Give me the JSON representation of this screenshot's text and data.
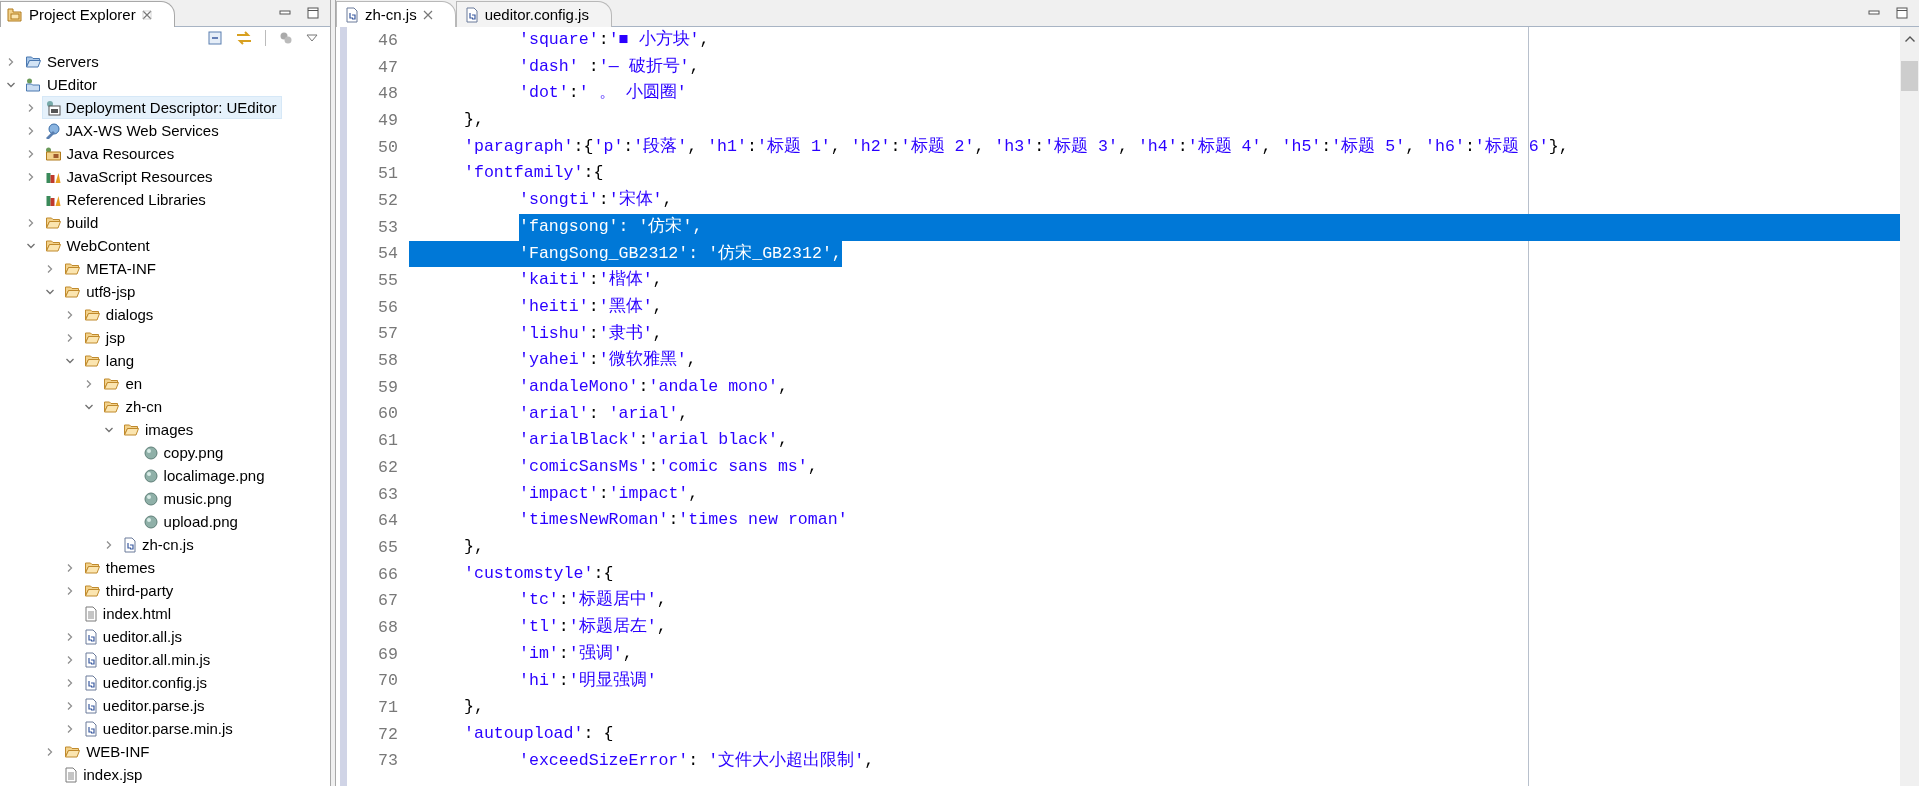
{
  "project_explorer": {
    "title": "Project Explorer",
    "tree": [
      {
        "label": "Servers",
        "kind": "servers",
        "selected": false,
        "expanded": false
      },
      {
        "label": "UEditor",
        "kind": "project",
        "selected": false,
        "expanded": true,
        "children": [
          {
            "label": "Deployment Descriptor: UEditor",
            "kind": "descriptor",
            "selected": true,
            "expanded": false
          },
          {
            "label": "JAX-WS Web Services",
            "kind": "webservice",
            "selected": false,
            "expanded": false
          },
          {
            "label": "Java Resources",
            "kind": "java-resources",
            "selected": false,
            "expanded": false
          },
          {
            "label": "JavaScript Resources",
            "kind": "library",
            "selected": false,
            "expanded": false
          },
          {
            "label": "Referenced Libraries",
            "kind": "library",
            "selected": false
          },
          {
            "label": "build",
            "kind": "folder",
            "selected": false,
            "expanded": false
          },
          {
            "label": "WebContent",
            "kind": "folder",
            "selected": false,
            "expanded": true,
            "children": [
              {
                "label": "META-INF",
                "kind": "folder",
                "selected": false,
                "expanded": false
              },
              {
                "label": "utf8-jsp",
                "kind": "folder",
                "selected": false,
                "expanded": true,
                "children": [
                  {
                    "label": "dialogs",
                    "kind": "folder",
                    "selected": false,
                    "expanded": false
                  },
                  {
                    "label": "jsp",
                    "kind": "folder",
                    "selected": false,
                    "expanded": false
                  },
                  {
                    "label": "lang",
                    "kind": "folder",
                    "selected": false,
                    "expanded": true,
                    "children": [
                      {
                        "label": "en",
                        "kind": "folder",
                        "selected": false,
                        "expanded": false
                      },
                      {
                        "label": "zh-cn",
                        "kind": "folder",
                        "selected": false,
                        "expanded": true,
                        "children": [
                          {
                            "label": "images",
                            "kind": "folder",
                            "selected": false,
                            "expanded": true,
                            "children": [
                              {
                                "label": "copy.png",
                                "kind": "image",
                                "selected": false
                              },
                              {
                                "label": "localimage.png",
                                "kind": "image",
                                "selected": false
                              },
                              {
                                "label": "music.png",
                                "kind": "image",
                                "selected": false
                              },
                              {
                                "label": "upload.png",
                                "kind": "image",
                                "selected": false
                              }
                            ]
                          },
                          {
                            "label": "zh-cn.js",
                            "kind": "js",
                            "selected": false,
                            "expanded": false
                          }
                        ]
                      }
                    ]
                  },
                  {
                    "label": "themes",
                    "kind": "folder",
                    "selected": false,
                    "expanded": false
                  },
                  {
                    "label": "third-party",
                    "kind": "folder",
                    "selected": false,
                    "expanded": false
                  },
                  {
                    "label": "index.html",
                    "kind": "html",
                    "selected": false
                  },
                  {
                    "label": "ueditor.all.js",
                    "kind": "js",
                    "selected": false,
                    "expanded": false
                  },
                  {
                    "label": "ueditor.all.min.js",
                    "kind": "js",
                    "selected": false,
                    "expanded": false
                  },
                  {
                    "label": "ueditor.config.js",
                    "kind": "js",
                    "selected": false,
                    "expanded": false
                  },
                  {
                    "label": "ueditor.parse.js",
                    "kind": "js",
                    "selected": false,
                    "expanded": false
                  },
                  {
                    "label": "ueditor.parse.min.js",
                    "kind": "js",
                    "selected": false,
                    "expanded": false
                  }
                ]
              },
              {
                "label": "WEB-INF",
                "kind": "folder",
                "selected": false,
                "expanded": false
              },
              {
                "label": "index.jsp",
                "kind": "html",
                "selected": false
              }
            ]
          }
        ]
      }
    ]
  },
  "editor": {
    "tabs": [
      {
        "label": "zh-cn.js",
        "selected": true
      },
      {
        "label": "ueditor.config.js",
        "selected": false
      }
    ],
    "lines": [
      {
        "number": "46",
        "text": "\t\t'square':'■ 小方块',",
        "selected": false
      },
      {
        "number": "47",
        "text": "\t\t'dash' :'— 破折号',",
        "selected": false
      },
      {
        "number": "48",
        "text": "\t\t'dot':' 。 小圆圈'",
        "selected": false
      },
      {
        "number": "49",
        "text": "\t},",
        "selected": false
      },
      {
        "number": "50",
        "text": "\t'paragraph':{'p':'段落', 'h1':'标题 1', 'h2':'标题 2', 'h3':'标题 3', 'h4':'标题 4', 'h5':'标题 5', 'h6':'标题 6'},",
        "selected": false
      },
      {
        "number": "51",
        "text": "\t'fontfamily':{",
        "selected": false
      },
      {
        "number": "52",
        "text": "\t\t'songti':'宋体',",
        "selected": false
      },
      {
        "number": "53",
        "text": "\t\t'fangsong': '仿宋',",
        "selected": true
      },
      {
        "number": "54",
        "text": "\t\t'FangSong_GB2312': '仿宋_GB2312',",
        "selected": true
      },
      {
        "number": "55",
        "text": "\t\t'kaiti':'楷体',",
        "selected": false
      },
      {
        "number": "56",
        "text": "\t\t'heiti':'黑体',",
        "selected": false
      },
      {
        "number": "57",
        "text": "\t\t'lishu':'隶书',",
        "selected": false
      },
      {
        "number": "58",
        "text": "\t\t'yahei':'微软雅黑',",
        "selected": false
      },
      {
        "number": "59",
        "text": "\t\t'andaleMono':'andale mono',",
        "selected": false
      },
      {
        "number": "60",
        "text": "\t\t'arial': 'arial',",
        "selected": false
      },
      {
        "number": "61",
        "text": "\t\t'arialBlack':'arial black',",
        "selected": false
      },
      {
        "number": "62",
        "text": "\t\t'comicSansMs':'comic sans ms',",
        "selected": false
      },
      {
        "number": "63",
        "text": "\t\t'impact':'impact',",
        "selected": false
      },
      {
        "number": "64",
        "text": "\t\t'timesNewRoman':'times new roman'",
        "selected": false
      },
      {
        "number": "65",
        "text": "\t},",
        "selected": false
      },
      {
        "number": "66",
        "text": "\t'customstyle':{",
        "selected": false
      },
      {
        "number": "67",
        "text": "\t\t'tc':'标题居中',",
        "selected": false
      },
      {
        "number": "68",
        "text": "\t\t'tl':'标题居左',",
        "selected": false
      },
      {
        "number": "69",
        "text": "\t\t'im':'强调',",
        "selected": false
      },
      {
        "number": "70",
        "text": "\t\t'hi':'明显强调'",
        "selected": false
      },
      {
        "number": "71",
        "text": "\t},",
        "selected": false
      },
      {
        "number": "72",
        "text": "\t'autoupload': {",
        "selected": false
      },
      {
        "number": "73",
        "text": "\t\t'exceedSizeError': '文件大小超出限制',",
        "selected": false
      }
    ]
  }
}
